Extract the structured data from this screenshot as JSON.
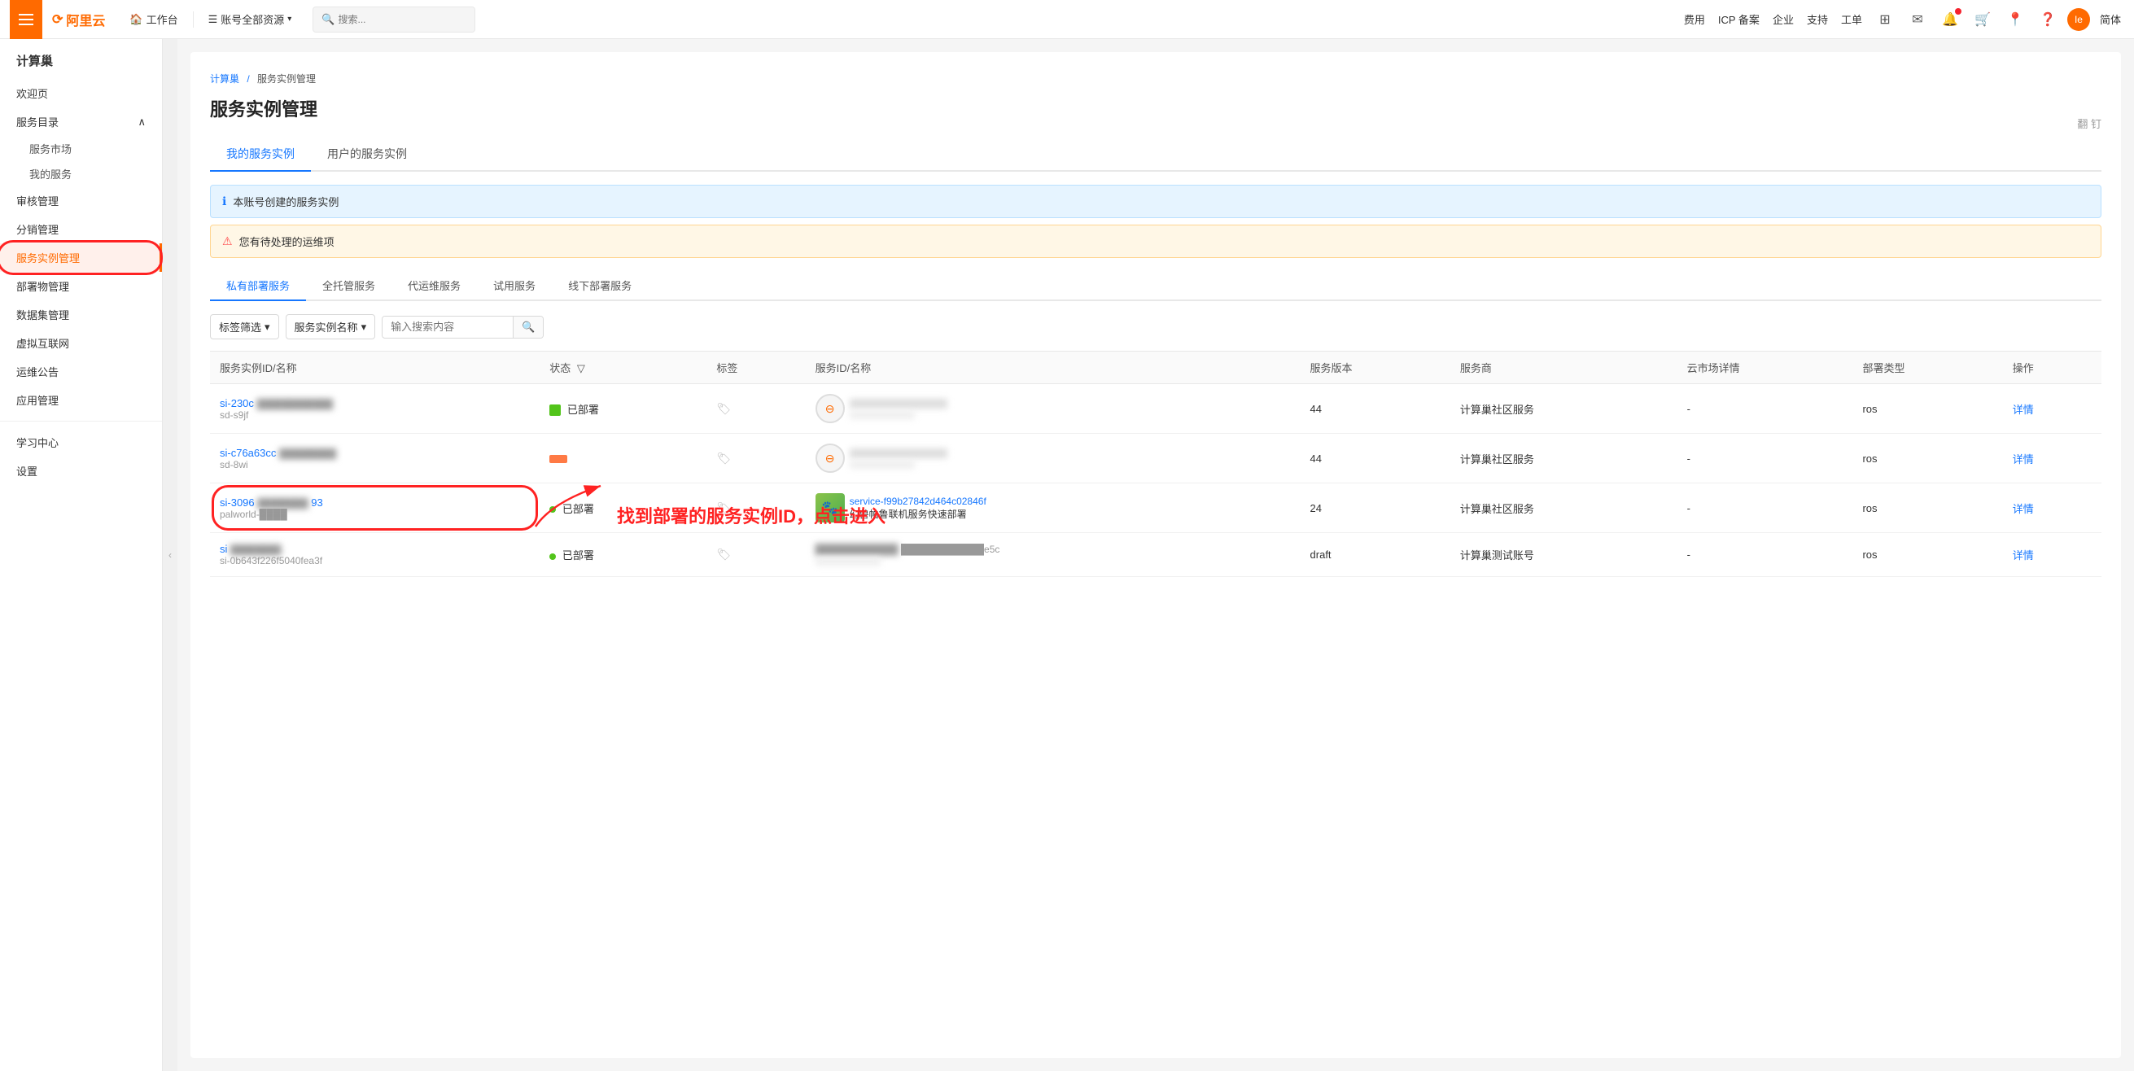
{
  "topNav": {
    "logo": "阿里云",
    "workbench": "工作台",
    "resources": "账号全部资源",
    "searchPlaceholder": "搜索...",
    "navItems": [
      "费用",
      "ICP 备案",
      "企业",
      "支持",
      "工单"
    ],
    "simplifiedLabel": "简体",
    "userInitials": "Ie"
  },
  "sidebar": {
    "title": "计算巢",
    "items": [
      {
        "label": "欢迎页",
        "active": false
      },
      {
        "label": "服务目录",
        "active": false,
        "expanded": true
      },
      {
        "label": "服务市场",
        "active": false,
        "sub": true
      },
      {
        "label": "我的服务",
        "active": false,
        "sub": true
      },
      {
        "label": "审核管理",
        "active": false
      },
      {
        "label": "分销管理",
        "active": false
      },
      {
        "label": "服务实例管理",
        "active": true
      },
      {
        "label": "部署物管理",
        "active": false
      },
      {
        "label": "数据集管理",
        "active": false
      },
      {
        "label": "虚拟互联网",
        "active": false
      },
      {
        "label": "运维公告",
        "active": false
      },
      {
        "label": "应用管理",
        "active": false
      }
    ],
    "bottomItems": [
      {
        "label": "学习中心"
      },
      {
        "label": "设置"
      }
    ]
  },
  "breadcrumb": {
    "items": [
      "计算巢",
      "服务实例管理"
    ]
  },
  "page": {
    "title": "服务实例管理",
    "pinLabel": "翻 钉"
  },
  "topTabs": [
    {
      "label": "我的服务实例",
      "active": true
    },
    {
      "label": "用户的服务实例",
      "active": false
    }
  ],
  "alerts": [
    {
      "type": "info",
      "text": "本账号创建的服务实例"
    },
    {
      "type": "warn",
      "text": "您有待处理的运维项"
    }
  ],
  "subTabs": [
    {
      "label": "私有部署服务",
      "active": true
    },
    {
      "label": "全托管服务",
      "active": false
    },
    {
      "label": "代运维服务",
      "active": false
    },
    {
      "label": "试用服务",
      "active": false
    },
    {
      "label": "线下部署服务",
      "active": false
    }
  ],
  "filters": {
    "tagFilter": "标签筛选",
    "instanceNameFilter": "服务实例名称",
    "searchPlaceholder": "输入搜索内容"
  },
  "tableColumns": [
    "服务实例ID/名称",
    "状态",
    "标签",
    "服务ID/名称",
    "服务版本",
    "服务商",
    "云市场详情",
    "部署类型",
    "操作"
  ],
  "tableRows": [
    {
      "id": "si-230c",
      "idFull": "si-230c████████████",
      "name": "sd-s9jf",
      "status": "已部署",
      "statusType": "green-square",
      "tags": "",
      "serviceId": "████████████████",
      "serviceVersion": "44",
      "provider": "计算巢社区服务",
      "marketDetail": "-",
      "deployType": "ros",
      "op": "详情",
      "hasThumb": false
    },
    {
      "id": "si-c76a63cc",
      "idFull": "si-c76a63cc████████",
      "name": "sd-8wi",
      "status": "",
      "statusType": "red-bar",
      "tags": "",
      "serviceId": "████████████████",
      "serviceVersion": "44",
      "provider": "计算巢社区服务",
      "marketDetail": "-",
      "deployType": "ros",
      "op": "详情",
      "hasThumb": false
    },
    {
      "id": "si-3096",
      "idFull": "si-3096██████████93",
      "name": "palworld-████",
      "status": "已部署",
      "statusType": "green-dot",
      "tags": "",
      "serviceId": "service-f99b27842d464c02846f",
      "serviceIdFull": "service-f99b27842d464c02846f",
      "serviceName": "幻兽帕鲁联机服务快速部署",
      "serviceVersion": "24",
      "provider": "计算巢社区服务",
      "marketDetail": "-",
      "deployType": "ros",
      "op": "详情",
      "hasThumb": true,
      "annotated": true
    },
    {
      "id": "si",
      "idFull": "si-0b6431226f50401ea3f",
      "name": "si-0b6431226f50401ea3f",
      "nameDisplay": "si-0b643f226f5040fea3f",
      "status": "已部署",
      "statusType": "green-dot",
      "tags": "",
      "serviceId": "████████████e5c",
      "serviceVersion": "draft",
      "provider": "计算巢测试账号",
      "marketDetail": "-",
      "deployType": "ros",
      "op": "详情",
      "hasThumb": false
    }
  ],
  "annotation": {
    "arrowText": "找到部署的服务实例ID，点击进入"
  }
}
